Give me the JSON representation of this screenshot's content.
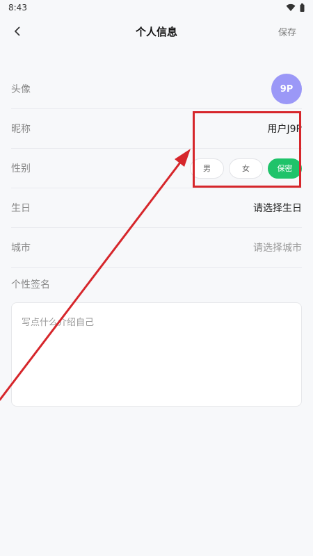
{
  "status_bar": {
    "time": "8:43"
  },
  "nav": {
    "title": "个人信息",
    "save_label": "保存"
  },
  "rows": {
    "avatar": {
      "label": "头像",
      "initials": "9P"
    },
    "nickname": {
      "label": "昵称",
      "value": "用户J9P"
    },
    "gender": {
      "label": "性别",
      "options": [
        "男",
        "女",
        "保密"
      ],
      "selected": "保密"
    },
    "birthday": {
      "label": "生日",
      "value": "请选择生日"
    },
    "city": {
      "label": "城市",
      "value": "请选择城市"
    }
  },
  "signature": {
    "label": "个性签名",
    "placeholder": "写点什么介绍自己"
  },
  "colors": {
    "accent": "#1fc36a",
    "avatar_bg": "#9b98f7",
    "annotation": "#d6262b"
  },
  "icons": {
    "back": "chevron-left-icon",
    "wifi": "wifi-icon",
    "battery": "battery-icon"
  }
}
